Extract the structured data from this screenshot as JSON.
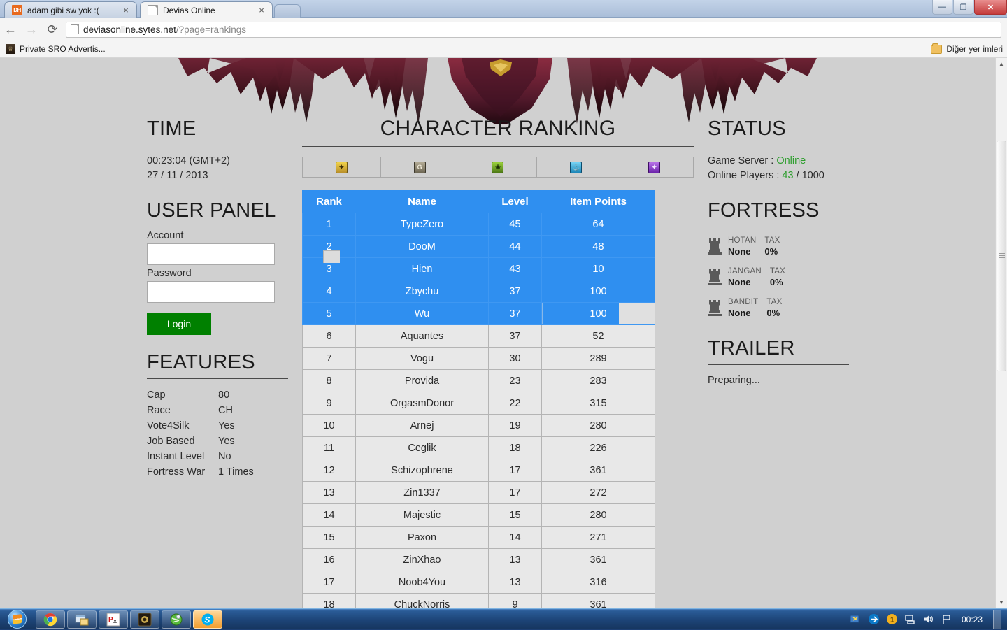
{
  "browser": {
    "tabs": [
      {
        "title": "adam gibi sw yok :(",
        "favicon": "dh-icon",
        "active": false,
        "close": "×"
      },
      {
        "title": "Devias Online",
        "favicon": "document-icon",
        "active": true,
        "close": "×"
      }
    ],
    "nav": {
      "back": "←",
      "forward": "→",
      "reload": "⟳"
    },
    "url_domain": "deviasonline.sytes.net",
    "url_path": "/?page=rankings",
    "star": "☆",
    "window_buttons": {
      "minimize": "—",
      "maximize": "❐",
      "close": "✕"
    },
    "bookmarks": {
      "items": [
        {
          "label": "Private SRO Advertis..."
        }
      ],
      "other": "Diğer yer imleri"
    }
  },
  "site": {
    "time": {
      "heading": "TIME",
      "clock": "00:23:04 (GMT+2)",
      "date": "27 / 11 / 2013"
    },
    "user_panel": {
      "heading": "USER PANEL",
      "account_label": "Account",
      "account_value": "",
      "password_label": "Password",
      "password_value": "",
      "login_label": "Login"
    },
    "features": {
      "heading": "FEATURES",
      "rows": [
        {
          "key": "Cap",
          "value": "80"
        },
        {
          "key": "Race",
          "value": "CH"
        },
        {
          "key": "Vote4Silk",
          "value": "Yes"
        },
        {
          "key": "Job Based",
          "value": "Yes"
        },
        {
          "key": "Instant Level",
          "value": "No"
        },
        {
          "key": "Fortress War",
          "value": "1 Times"
        }
      ]
    },
    "ranking": {
      "heading": "CHARACTER RANKING",
      "tabs": [
        {
          "icon": "gold-badge-icon",
          "glyph": "✦",
          "color": "#d9b232"
        },
        {
          "icon": "guild-badge-icon",
          "glyph": "G",
          "color": "#8a8269"
        },
        {
          "icon": "green-badge-icon",
          "glyph": "❀",
          "color": "#6fa424"
        },
        {
          "icon": "blue-badge-icon",
          "glyph": "⚓",
          "color": "#2e9fd4"
        },
        {
          "icon": "purple-badge-icon",
          "glyph": "✦",
          "color": "#8b3fc4"
        }
      ],
      "columns": [
        "Rank",
        "Name",
        "Level",
        "Item Points"
      ],
      "selected_color": "#2f8ff0",
      "rows": [
        {
          "rank": "1",
          "name": "TypeZero",
          "level": "45",
          "points": "64",
          "selected": true
        },
        {
          "rank": "2",
          "name": "DooM",
          "level": "44",
          "points": "48",
          "selected": true
        },
        {
          "rank": "3",
          "name": "Hien",
          "level": "43",
          "points": "10",
          "selected": true
        },
        {
          "rank": "4",
          "name": "Zbychu",
          "level": "37",
          "points": "100",
          "selected": true
        },
        {
          "rank": "5",
          "name": "Wu",
          "level": "37",
          "points": "100",
          "selected": true,
          "partial": true
        },
        {
          "rank": "6",
          "name": "Aquantes",
          "level": "37",
          "points": "52",
          "selected": false
        },
        {
          "rank": "7",
          "name": "Vogu",
          "level": "30",
          "points": "289",
          "selected": false
        },
        {
          "rank": "8",
          "name": "Provida",
          "level": "23",
          "points": "283",
          "selected": false
        },
        {
          "rank": "9",
          "name": "OrgasmDonor",
          "level": "22",
          "points": "315",
          "selected": false
        },
        {
          "rank": "10",
          "name": "Arnej",
          "level": "19",
          "points": "280",
          "selected": false
        },
        {
          "rank": "11",
          "name": "Ceglik",
          "level": "18",
          "points": "226",
          "selected": false
        },
        {
          "rank": "12",
          "name": "Schizophrene",
          "level": "17",
          "points": "361",
          "selected": false
        },
        {
          "rank": "13",
          "name": "Zin1337",
          "level": "17",
          "points": "272",
          "selected": false
        },
        {
          "rank": "14",
          "name": "Majestic",
          "level": "15",
          "points": "280",
          "selected": false
        },
        {
          "rank": "15",
          "name": "Paxon",
          "level": "14",
          "points": "271",
          "selected": false
        },
        {
          "rank": "16",
          "name": "ZinXhao",
          "level": "13",
          "points": "361",
          "selected": false
        },
        {
          "rank": "17",
          "name": "Noob4You",
          "level": "13",
          "points": "316",
          "selected": false
        },
        {
          "rank": "18",
          "name": "ChuckNorris",
          "level": "9",
          "points": "361",
          "selected": false
        }
      ]
    },
    "status": {
      "heading": "STATUS",
      "server_label": "Game Server :",
      "server_value": "Online",
      "players_label": "Online Players :",
      "players_online": "43",
      "players_max": "/ 1000",
      "online_color": "#2f9e2f"
    },
    "fortress": {
      "heading": "FORTRESS",
      "items": [
        {
          "name": "HOTAN",
          "owner": "None",
          "tax_label": "TAX",
          "tax_value": "0%"
        },
        {
          "name": "JANGAN",
          "owner": "None",
          "tax_label": "TAX",
          "tax_value": "0%"
        },
        {
          "name": "BANDIT",
          "owner": "None",
          "tax_label": "TAX",
          "tax_value": "0%"
        }
      ]
    },
    "trailer": {
      "heading": "TRAILER",
      "text": "Preparing..."
    }
  },
  "taskbar": {
    "items": [
      {
        "name": "chrome",
        "active": false
      },
      {
        "name": "window-switcher",
        "active": false
      },
      {
        "name": "px-editor",
        "active": false
      },
      {
        "name": "dark-game",
        "active": false
      },
      {
        "name": "green-globe",
        "active": false
      },
      {
        "name": "skype",
        "active": true
      }
    ],
    "clock": "00:23"
  }
}
